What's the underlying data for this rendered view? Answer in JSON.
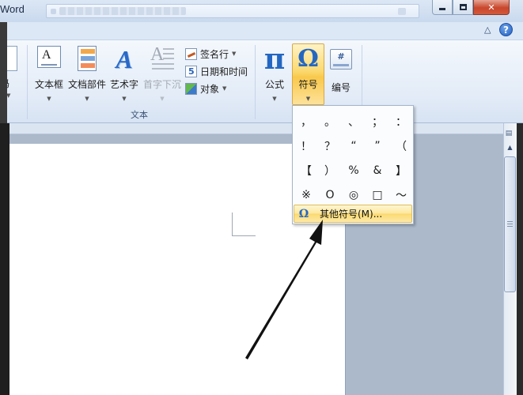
{
  "window": {
    "app_name": "Word"
  },
  "ribbon": {
    "left_partial_label": "码",
    "group_label": "文本",
    "buttons": {
      "textbox": "文本框",
      "quick_parts": "文档部件",
      "wordart": "艺术字",
      "dropcap": "首字下沉",
      "equation": "公式",
      "symbol": "符号",
      "numbering": "编号"
    },
    "small_items": {
      "signature_line": "签名行",
      "date_time": "日期和时间",
      "object": "对象"
    },
    "numbering_icon_glyph": "#"
  },
  "symbol_menu": {
    "symbols": [
      "，",
      "。",
      "、",
      "；",
      "：",
      "！",
      "？",
      "“",
      "”",
      "（",
      "【",
      "）",
      "%",
      "&",
      "】",
      "※",
      "O",
      "◎",
      "□",
      "～"
    ],
    "more_symbols_label": "其他符号(M)..."
  },
  "colors": {
    "accent_blue": "#2467c2",
    "highlight_gold": "#f9c84c",
    "ribbon_bg": "#e2ebf7"
  },
  "icons": {
    "equation": "pi-icon",
    "symbol": "omega-icon",
    "help": "help-icon"
  }
}
